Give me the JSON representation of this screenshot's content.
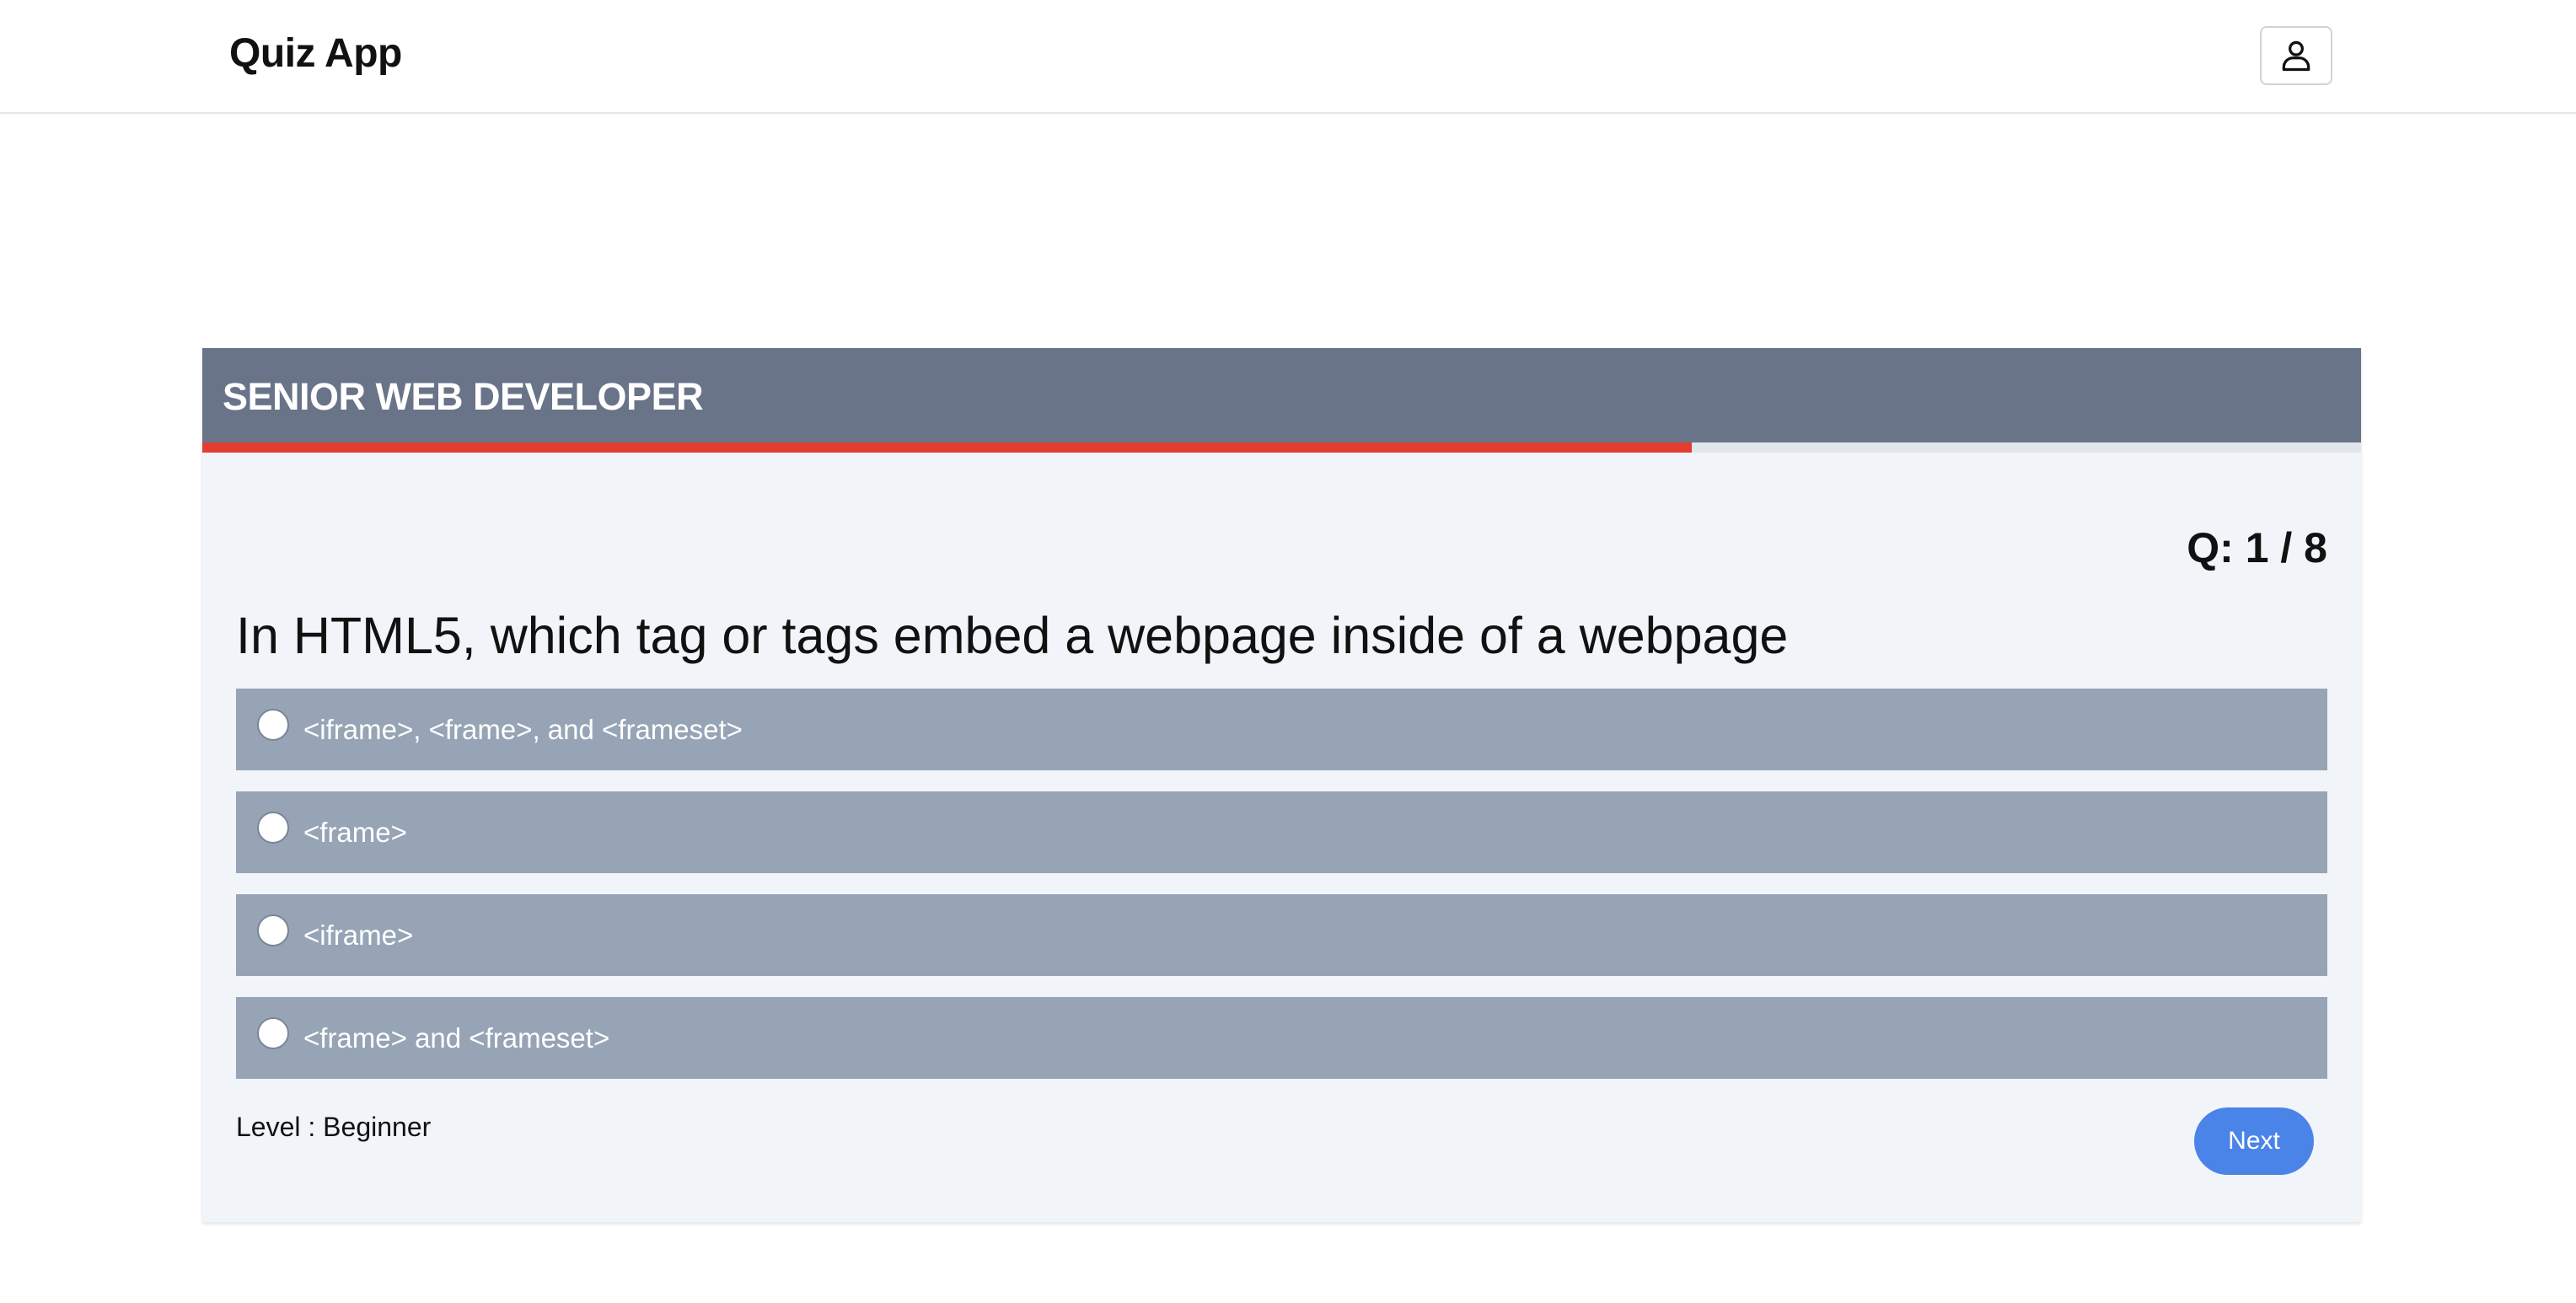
{
  "header": {
    "app_title": "Quiz App",
    "user_icon": "user-icon"
  },
  "quiz": {
    "title": "SENIOR WEB DEVELOPER",
    "progress": 0.69,
    "counter": "Q: 1 / 8",
    "question": "In HTML5, which tag or tags embed a webpage inside of a webpage",
    "options": [
      {
        "label": "<iframe>, <frame>, and <frameset>",
        "selected": false
      },
      {
        "label": "<frame>",
        "selected": false
      },
      {
        "label": "<iframe>",
        "selected": false
      },
      {
        "label": "<frame> and <frameset>",
        "selected": false
      }
    ],
    "level": "Level : Beginner",
    "next_label": "Next"
  },
  "colors": {
    "header_bar": "#697489",
    "progress": "#e43d30",
    "option_bg": "#97a4b6",
    "next_button": "#4a84e8",
    "card_bg": "#f1f4f8"
  }
}
